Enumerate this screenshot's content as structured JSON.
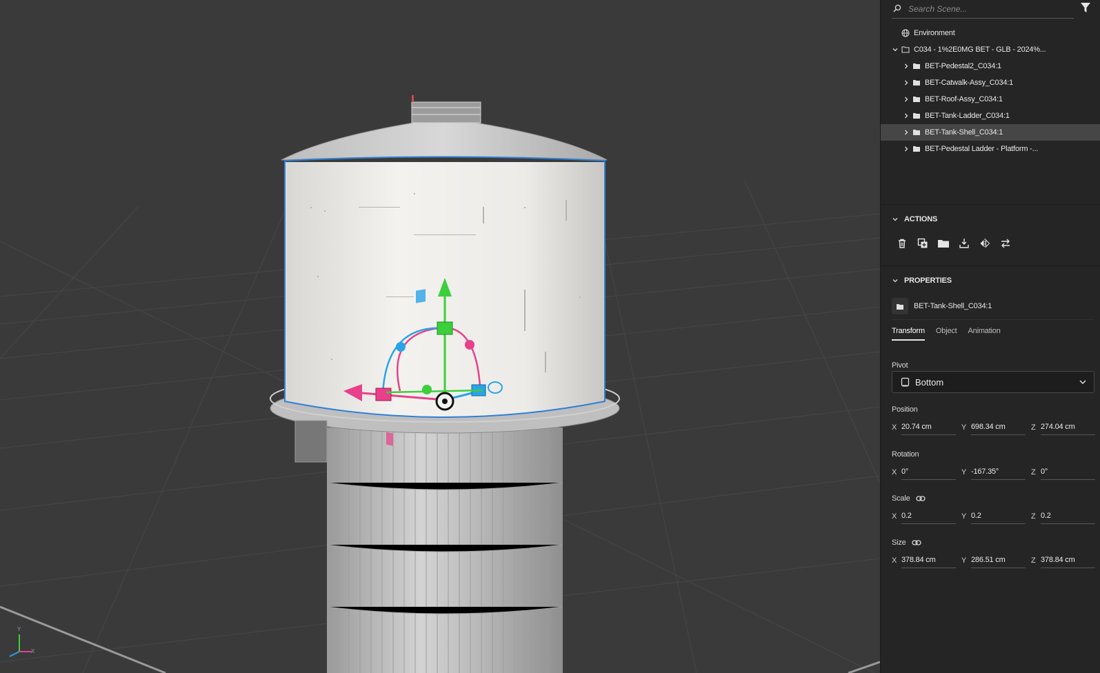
{
  "search": {
    "placeholder": "Search Scene..."
  },
  "tree": {
    "environment_label": "Environment",
    "root_label": "C034 - 1%2E0MG BET - GLB - 2024%...",
    "children": [
      {
        "label": "BET-Pedestal2_C034:1"
      },
      {
        "label": "BET-Catwalk-Assy_C034:1"
      },
      {
        "label": "BET-Roof-Assy_C034:1"
      },
      {
        "label": "BET-Tank-Ladder_C034:1"
      },
      {
        "label": "BET-Tank-Shell_C034:1",
        "selected": true
      },
      {
        "label": "BET-Pedestal Ladder - Platform -..."
      }
    ]
  },
  "actions": {
    "title": "ACTIONS",
    "icons": [
      "delete-icon",
      "duplicate-icon",
      "group-folder-icon",
      "drop-to-ground-icon",
      "mirror-icon",
      "swap-icon"
    ]
  },
  "properties": {
    "title": "PROPERTIES",
    "object_name": "BET-Tank-Shell_C034:1",
    "tabs": [
      "Transform",
      "Object",
      "Animation"
    ],
    "active_tab": "Transform",
    "pivot_label": "Pivot",
    "pivot_value": "Bottom",
    "position_label": "Position",
    "position": {
      "x": "20.74 cm",
      "y": "698.34 cm",
      "z": "274.04 cm"
    },
    "rotation_label": "Rotation",
    "rotation": {
      "x": "0°",
      "y": "-167.35°",
      "z": "0°"
    },
    "scale_label": "Scale",
    "scale": {
      "x": "0.2",
      "y": "0.2",
      "z": "0.2"
    },
    "size_label": "Size",
    "size": {
      "x": "378.84 cm",
      "y": "286.51 cm",
      "z": "378.84 cm"
    }
  },
  "axis_labels": {
    "x": "X",
    "y": "Y",
    "z": "Z"
  },
  "colors": {
    "selection_outline": "#2f7fd8",
    "gizmo_green": "#3ccf3c",
    "gizmo_pink": "#e8408a",
    "gizmo_blue": "#2aa4e8"
  }
}
